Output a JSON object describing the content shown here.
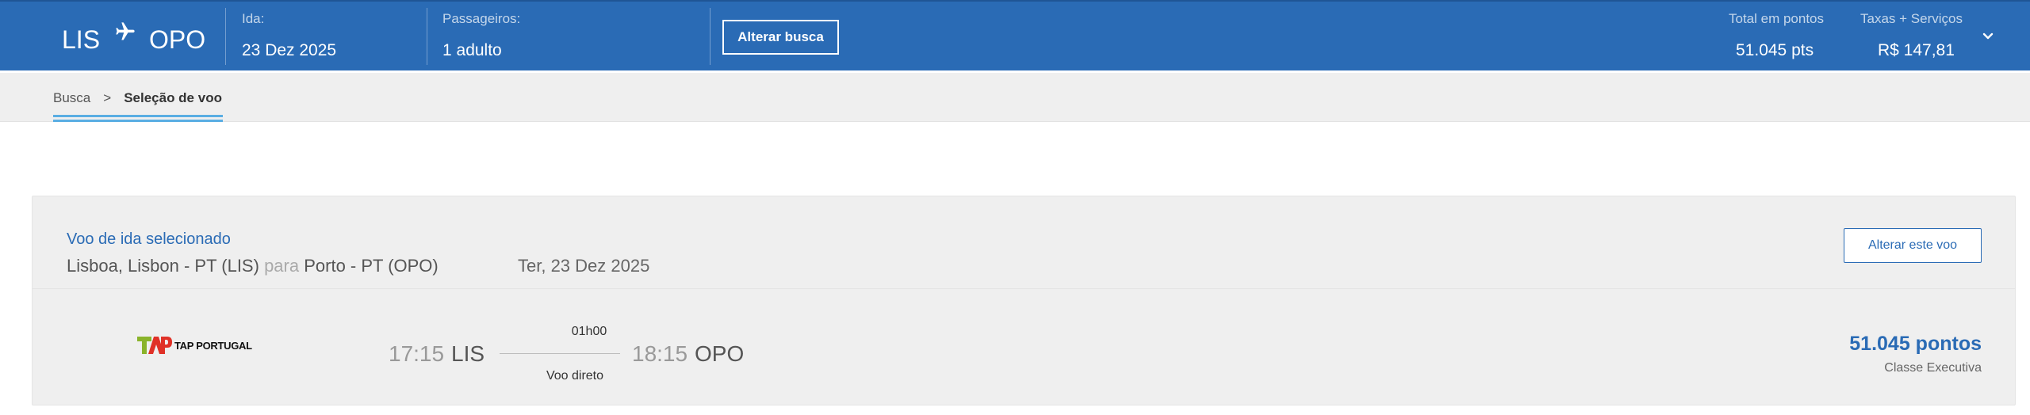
{
  "header": {
    "origin": "LIS",
    "destination": "OPO",
    "departure_label": "Ida:",
    "departure_value": "23 Dez 2025",
    "passengers_label": "Passageiros:",
    "passengers_value": "1 adulto",
    "alter_search_label": "Alterar busca",
    "total_points_label": "Total em pontos",
    "total_points_value": "51.045 pts",
    "fees_label": "Taxas + Serviços",
    "fees_value": "R$ 147,81",
    "icons": {
      "route": "airplane-icon",
      "expand": "chevron-down-icon"
    }
  },
  "breadcrumb": {
    "items": [
      {
        "label": "Busca"
      },
      {
        "label": ">"
      },
      {
        "label": "Seleção de voo"
      }
    ]
  },
  "selected_flight": {
    "title": "Voo de ida selecionado",
    "origin_full": "Lisboa, Lisbon - PT (LIS)",
    "connector": "para",
    "destination_full": "Porto - PT (OPO)",
    "date": "Ter, 23 Dez 2025",
    "change_button_label": "Alterar este voo",
    "airline_name": "TAP PORTUGAL",
    "departure_time": "17:15",
    "departure_code": "LIS",
    "duration": "01h00",
    "stops": "Voo direto",
    "arrival_time": "18:15",
    "arrival_code": "OPO",
    "points": "51.045 pontos",
    "cabin": "Classe Executiva"
  },
  "colors": {
    "brand_blue": "#2a6bb5",
    "header_bg": "#2a6bb5",
    "breadcrumb_accent": "#5aaee3",
    "card_bg": "#efefef",
    "tap_green": "#8ab32b",
    "tap_red": "#e03127"
  }
}
